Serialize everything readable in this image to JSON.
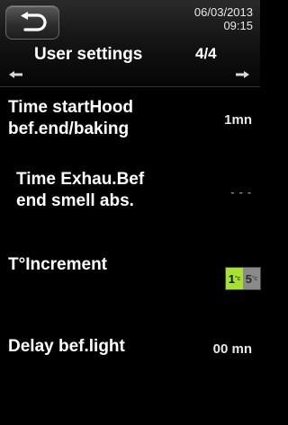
{
  "header": {
    "date": "06/03/2013",
    "time": "09:15",
    "title": "User settings",
    "page": "4/4"
  },
  "settings": [
    {
      "label_line1": "Time startHood",
      "label_line2": "bef.end/baking",
      "value": "1mn"
    },
    {
      "label_line1": "Time Exhau.Bef",
      "label_line2": "end smell abs.",
      "value": "- - -"
    },
    {
      "label_line1": "T°Increment",
      "options": [
        "1",
        "5"
      ],
      "unit": "°c",
      "selected": "1"
    },
    {
      "label_line1": "Delay bef.light",
      "value": "00 mn"
    }
  ],
  "colors": {
    "selected_option": "#a6e22e",
    "unselected_option": "#8a8a8a"
  },
  "icons": {
    "back": "back-arrow-icon",
    "prev": "left-arrow-icon",
    "next": "right-arrow-icon"
  }
}
